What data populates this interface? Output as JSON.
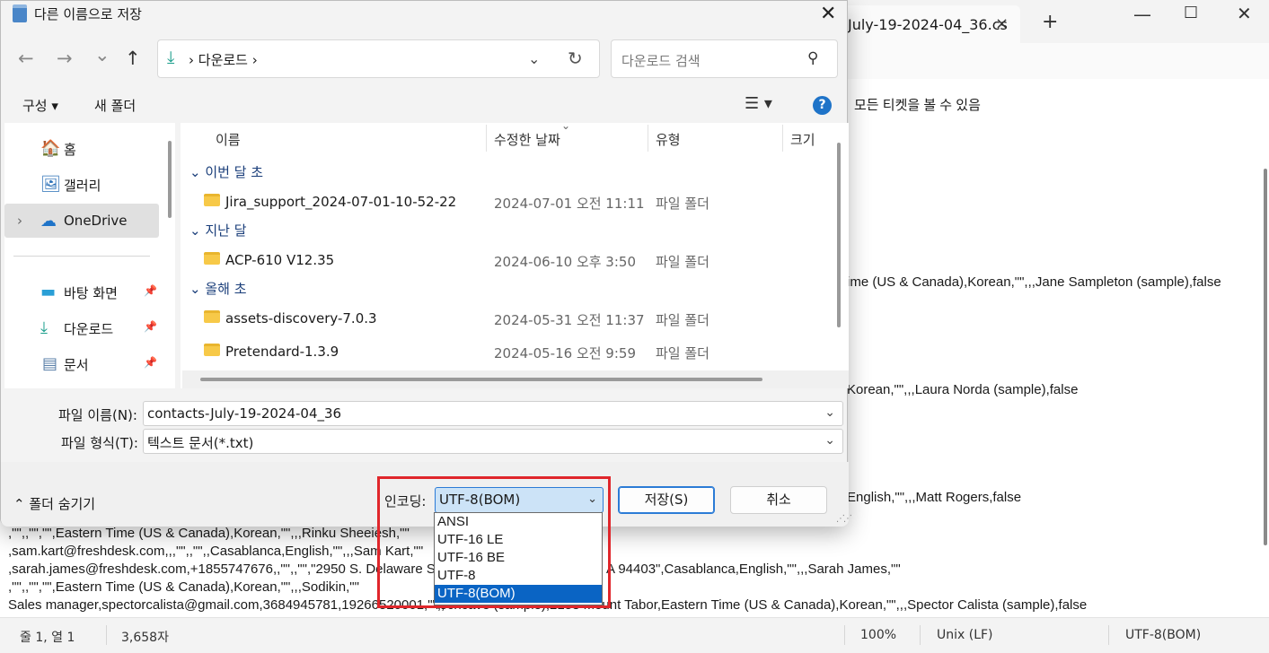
{
  "notepad": {
    "tab_title": "July-19-2024-04_36.cs",
    "tab_close_icon": "×",
    "new_tab_icon": "+",
    "min_icon": "—",
    "max_icon": "☐",
    "close_icon": "✕",
    "settings_icon": "⚙",
    "lines": [
      "모든 티켓을 볼 수 있음",
      "ime (US & Canada),Korean,\"\",,,Jane Sampleton (sample),false",
      "Korean,\"\",,,Laura Norda (sample),false",
      "English,\"\",,,Matt Rogers,false",
      ",\"\",,\"\",\"\",Eastern Time (US & Canada),Korean,\"\",,,Rinku Sheeiesh,\"\"",
      ",sam.kart@freshdesk.com,,,\"\",,\"\",,Casablanca,English,\"\",,,Sam Kart,\"\"",
      ",sarah.james@freshdesk.com,+1855747676,,\"\",,\"\",\"2950 S. Delaware Stre",
      "A 94403\",Casablanca,English,\"\",,,Sarah James,\"\"",
      ",\"\",,\"\",\"\",Eastern Time (US & Canada),Korean,\"\",,,Sodikin,\"\"",
      "Sales manager,spectorcalista@gmail.com,3684945781,19266520001,\"\",,",
      "Techcave (sample),2158 Mount Tabor,Eastern Time (US & Canada),Korean,\"\",,,Spector Calista (sample),false"
    ],
    "status": {
      "position": "줄 1, 열 1",
      "chars": "3,658자",
      "zoom": "100%",
      "line_ending": "Unix (LF)",
      "encoding": "UTF-8(BOM)"
    }
  },
  "dialog": {
    "title": "다른 이름으로 저장",
    "close_icon": "✕",
    "nav": {
      "back": "←",
      "forward": "→",
      "recent": "⌄",
      "up": "↑"
    },
    "address": {
      "icon": "⤓",
      "path": "›  다운로드  ›",
      "dropdown": "⌄",
      "refresh": "↻"
    },
    "search": {
      "placeholder": "다운로드 검색",
      "icon": "⚲"
    },
    "commands": {
      "organize": "구성 ▾",
      "new_folder": "새 폴더",
      "view_icon": "☰  ▾",
      "help_icon": "?"
    },
    "nav_pane": {
      "items": [
        {
          "icon": "🏠",
          "label": "홈"
        },
        {
          "icon": "🖼",
          "label": "갤러리"
        },
        {
          "expand": "›",
          "icon": "☁",
          "label": "OneDrive"
        },
        {
          "icon": "▬",
          "label": "바탕 화면",
          "pin": "📌"
        },
        {
          "icon": "⤓",
          "label": "다운로드",
          "pin": "📌"
        },
        {
          "icon": "▤",
          "label": "문서",
          "pin": "📌"
        }
      ]
    },
    "columns": {
      "name": "이름",
      "modified": "수정한 날짜",
      "type": "유형",
      "size": "크기",
      "sort_icon": "⌄"
    },
    "groups": [
      {
        "label": "⌄ 이번 달 초",
        "files": [
          {
            "name": "Jira_support_2024-07-01-10-52-22",
            "date": "2024-07-01 오전 11:11",
            "type": "파일 폴더"
          }
        ]
      },
      {
        "label": "⌄ 지난 달",
        "files": [
          {
            "name": "ACP-610 V12.35",
            "date": "2024-06-10 오후 3:50",
            "type": "파일 폴더"
          }
        ]
      },
      {
        "label": "⌄ 올해 초",
        "files": [
          {
            "name": "assets-discovery-7.0.3",
            "date": "2024-05-31 오전 11:37",
            "type": "파일 폴더"
          },
          {
            "name": "Pretendard-1.3.9",
            "date": "2024-05-16 오전 9:59",
            "type": "파일 폴더"
          }
        ]
      }
    ],
    "filename": {
      "label": "파일 이름(N):",
      "value": "contacts-July-19-2024-04_36",
      "chev": "⌄"
    },
    "filetype": {
      "label": "파일 형식(T):",
      "value": "텍스트 문서(*.txt)",
      "chev": "⌄"
    },
    "footer": {
      "hide_folders": "⌃  폴더 숨기기",
      "encoding_label": "인코딩:",
      "encoding_value": "UTF-8(BOM)",
      "encoding_chev": "⌄",
      "save": "저장(S)",
      "cancel": "취소",
      "grip": "⋰⋰"
    },
    "encoding_options": [
      "ANSI",
      "UTF-16 LE",
      "UTF-16 BE",
      "UTF-8",
      "UTF-8(BOM)"
    ],
    "encoding_selected_index": 4
  }
}
